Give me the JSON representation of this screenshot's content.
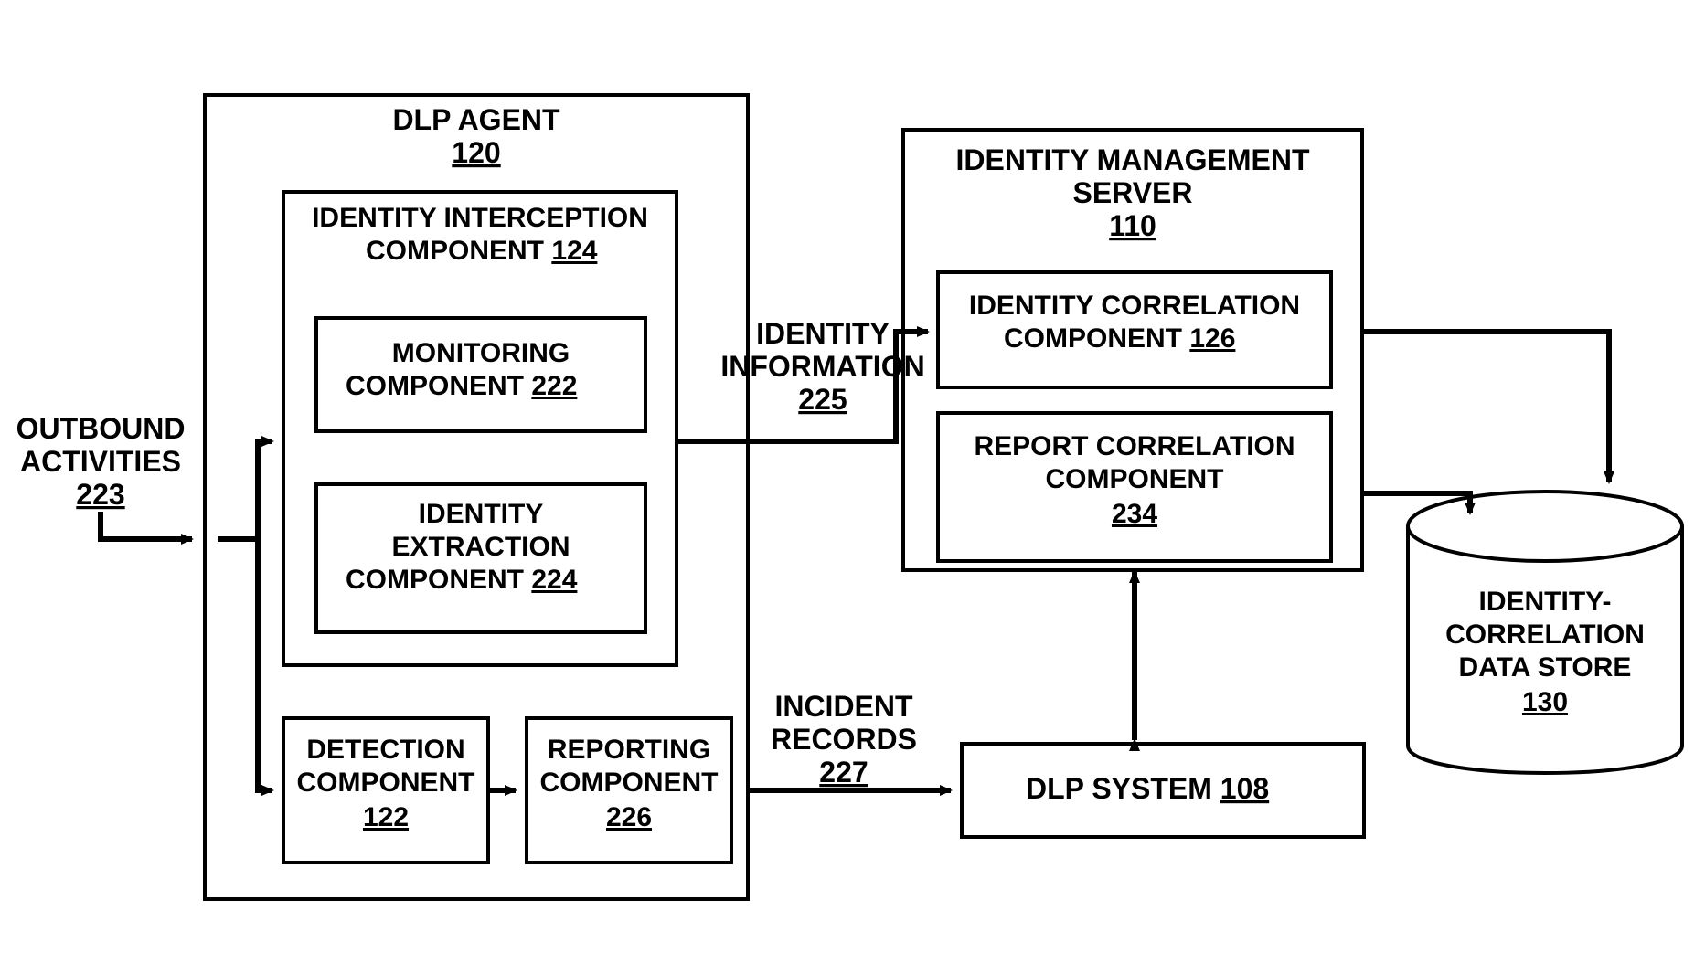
{
  "outbound": {
    "line1": "OUTBOUND",
    "line2": "ACTIVITIES",
    "ref": "223"
  },
  "dlpAgent": {
    "label": "DLP AGENT",
    "ref": "120"
  },
  "iic": {
    "line1": "IDENTITY INTERCEPTION",
    "line2": "COMPONENT",
    "ref": "124"
  },
  "monitoring": {
    "line1": "MONITORING",
    "line2": "COMPONENT",
    "ref": "222"
  },
  "extraction": {
    "line1": "IDENTITY",
    "line2": "EXTRACTION",
    "line3": "COMPONENT",
    "ref": "224"
  },
  "detection": {
    "line1": "DETECTION",
    "line2": "COMPONENT",
    "ref": "122"
  },
  "reporting": {
    "line1": "REPORTING",
    "line2": "COMPONENT",
    "ref": "226"
  },
  "identityInfo": {
    "line1": "IDENTITY",
    "line2": "INFORMATION",
    "ref": "225"
  },
  "ims": {
    "line1": "IDENTITY MANAGEMENT",
    "line2": "SERVER",
    "ref": "110"
  },
  "icc": {
    "line1": "IDENTITY CORRELATION",
    "line2": "COMPONENT",
    "ref": "126"
  },
  "rcc": {
    "line1": "REPORT CORRELATION",
    "line2": "COMPONENT",
    "ref": "234"
  },
  "incident": {
    "line1": "INCIDENT",
    "line2": "RECORDS",
    "ref": "227"
  },
  "dlpSystem": {
    "line1": "DLP SYSTEM",
    "ref": "108"
  },
  "datastore": {
    "line1": "IDENTITY-",
    "line2": "CORRELATION",
    "line3": "DATA STORE",
    "ref": "130"
  }
}
